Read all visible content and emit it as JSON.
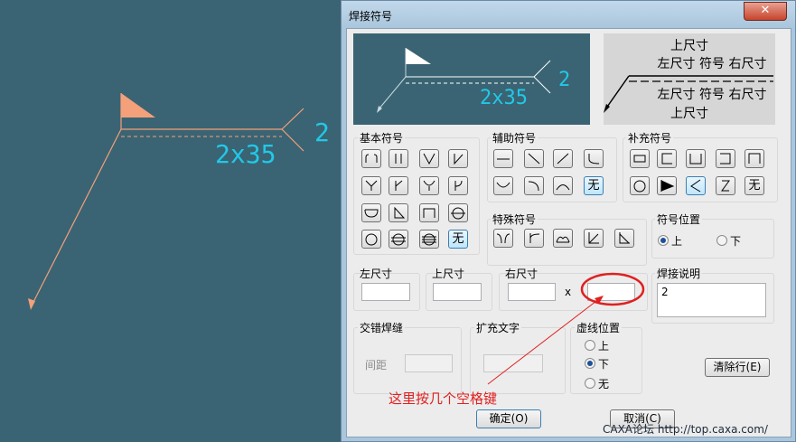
{
  "canvas": {
    "weld_left_dim": "2",
    "weld_right_dim": "2x35"
  },
  "dialog": {
    "title": "焊接符号",
    "close_label": "✕",
    "preview": {
      "left_dim": "2",
      "right_dim": "2x35"
    },
    "legend": {
      "upper_title": "上尺寸",
      "upper_row": "左尺寸 符号 右尺寸",
      "lower_row": "左尺寸 符号 右尺寸",
      "lower_title": "上尺寸"
    },
    "groups": {
      "basic": "基本符号",
      "aux": "辅助符号",
      "supp": "补充符号",
      "special": "特殊符号",
      "position": "符号位置",
      "interleave": "交错焊缝",
      "expand": "扩充文字",
      "dashpos": "虚线位置",
      "desc": "焊接说明"
    },
    "none_label": "无",
    "fields": {
      "left_label": "左尺寸",
      "left_value": "",
      "upper_label": "上尺寸",
      "upper_value": "",
      "right_label": "右尺寸",
      "right_value": "",
      "x_label": "x",
      "right2_value": "",
      "spacing_label": "间距",
      "desc_value": "2"
    },
    "position_options": [
      "上",
      "下"
    ],
    "position_selected": "上",
    "dash_options": [
      "上",
      "下",
      "无"
    ],
    "dash_selected": "下",
    "buttons": {
      "clear": "清除行(E)",
      "ok": "确定(O)",
      "cancel": "取消(C)"
    }
  },
  "annotation": {
    "text": "这里按几个空格键"
  },
  "watermark": "CAXA论坛 http://top.caxa.com/",
  "colors": {
    "canvas_bg": "#3a6473",
    "weld_line": "#f4a07a",
    "dim_text": "#22c8e8",
    "annotation": "#e02020"
  }
}
